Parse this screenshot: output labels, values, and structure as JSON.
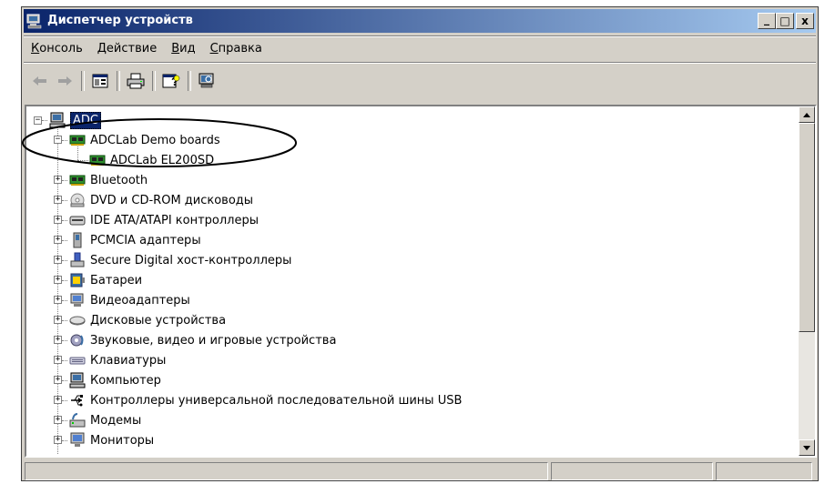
{
  "window": {
    "title": "Диспетчер устройств"
  },
  "caption_buttons": {
    "minimize": "_",
    "maximize": "□",
    "close": "x"
  },
  "menu": [
    {
      "label_u": "К",
      "label_rest": "онсоль"
    },
    {
      "label_u": "Д",
      "label_rest": "ействие"
    },
    {
      "label_u": "В",
      "label_rest": "ид"
    },
    {
      "label_u": "С",
      "label_rest": "правка"
    }
  ],
  "toolbar": {
    "buttons": [
      "back-icon",
      "forward-icon",
      "properties-icon",
      "print-icon",
      "help-icon",
      "scan-hardware-icon"
    ]
  },
  "tree": {
    "root": "ADC",
    "items": [
      {
        "label": "ADCLab Demo boards",
        "icon": "board-icon",
        "expanded": true
      },
      {
        "label": "ADCLab EL200SD",
        "icon": "board-icon",
        "child": true
      },
      {
        "label": "Bluetooth",
        "icon": "board-icon"
      },
      {
        "label": "DVD и CD-ROM дисководы",
        "icon": "cdrom-icon"
      },
      {
        "label": "IDE ATA/ATAPI контроллеры",
        "icon": "ide-icon"
      },
      {
        "label": "PCMCIA адаптеры",
        "icon": "pcmcia-icon"
      },
      {
        "label": "Secure Digital хост-контроллеры",
        "icon": "sd-icon"
      },
      {
        "label": "Батареи",
        "icon": "battery-icon"
      },
      {
        "label": "Видеоадаптеры",
        "icon": "display-icon"
      },
      {
        "label": "Дисковые устройства",
        "icon": "disk-icon"
      },
      {
        "label": "Звуковые, видео и игровые устройства",
        "icon": "sound-icon"
      },
      {
        "label": "Клавиатуры",
        "icon": "keyboard-icon"
      },
      {
        "label": "Компьютер",
        "icon": "computer-icon"
      },
      {
        "label": "Контроллеры универсальной последовательной шины USB",
        "icon": "usb-icon"
      },
      {
        "label": "Модемы",
        "icon": "modem-icon"
      },
      {
        "label": "Мониторы",
        "icon": "monitor-icon"
      }
    ]
  },
  "colors": {
    "titlebar_start": "#0a246a",
    "titlebar_end": "#a6caf0",
    "selection": "#0a246a",
    "window_face": "#d4d0c8"
  }
}
